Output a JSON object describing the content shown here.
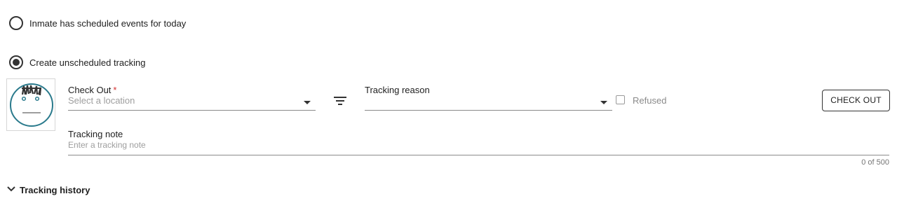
{
  "radios": {
    "scheduled": {
      "label": "Inmate has scheduled events for today",
      "selected": false
    },
    "unscheduled": {
      "label": "Create unscheduled tracking",
      "selected": true
    }
  },
  "avatar": {
    "icon": "face-placeholder-icon",
    "color": "#2a7a8c"
  },
  "check_out": {
    "label": "Check Out",
    "required_mark": "*",
    "placeholder": "Select a location",
    "value": ""
  },
  "filter": {
    "icon": "filter-icon"
  },
  "tracking_reason": {
    "label": "Tracking reason",
    "value": ""
  },
  "refused": {
    "label": "Refused",
    "checked": false
  },
  "check_out_button": {
    "label": "CHECK OUT"
  },
  "tracking_note": {
    "label": "Tracking note",
    "placeholder": "Enter a tracking note",
    "value": "",
    "counter": "0 of 500"
  },
  "tracking_history": {
    "label": "Tracking history",
    "icon": "chevron-down-icon"
  },
  "colors": {
    "required": "#d32f2f",
    "text": "#212121",
    "muted": "#9e9e9e"
  }
}
